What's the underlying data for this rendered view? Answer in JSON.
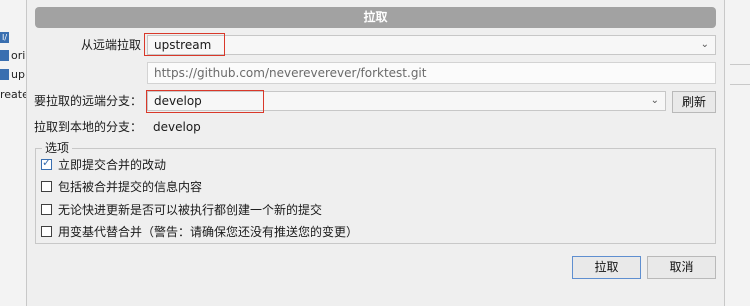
{
  "background": {
    "left_items": [
      {
        "icon": "I/",
        "text": ""
      },
      {
        "icon": "",
        "text": "ori"
      },
      {
        "icon": "",
        "text": "up"
      },
      {
        "icon": "",
        "text": "reate"
      }
    ]
  },
  "dialog": {
    "title": "拉取",
    "remote_label": "从远端拉取",
    "remote_value": "upstream",
    "remote_url": "https://github.com/nevereverever/forktest.git",
    "branch_label": "要拉取的远端分支：",
    "branch_value": "develop",
    "refresh_label": "刷新",
    "local_label": "拉取到本地的分支：",
    "local_value": "develop",
    "options_title": "选项",
    "options": [
      {
        "label": "立即提交合并的改动",
        "checked": true
      },
      {
        "label": "包括被合并提交的信息内容",
        "checked": false
      },
      {
        "label": "无论快进更新是否可以被执行都创建一个新的提交",
        "checked": false
      },
      {
        "label": "用变基代替合并（警告：请确保您还没有推送您的变更）",
        "checked": false
      }
    ],
    "ok_label": "拉取",
    "cancel_label": "取消"
  },
  "colors": {
    "accent": "#3a6fb0",
    "highlight_box": "#d9382a",
    "title_bar": "#a2a2a2"
  }
}
